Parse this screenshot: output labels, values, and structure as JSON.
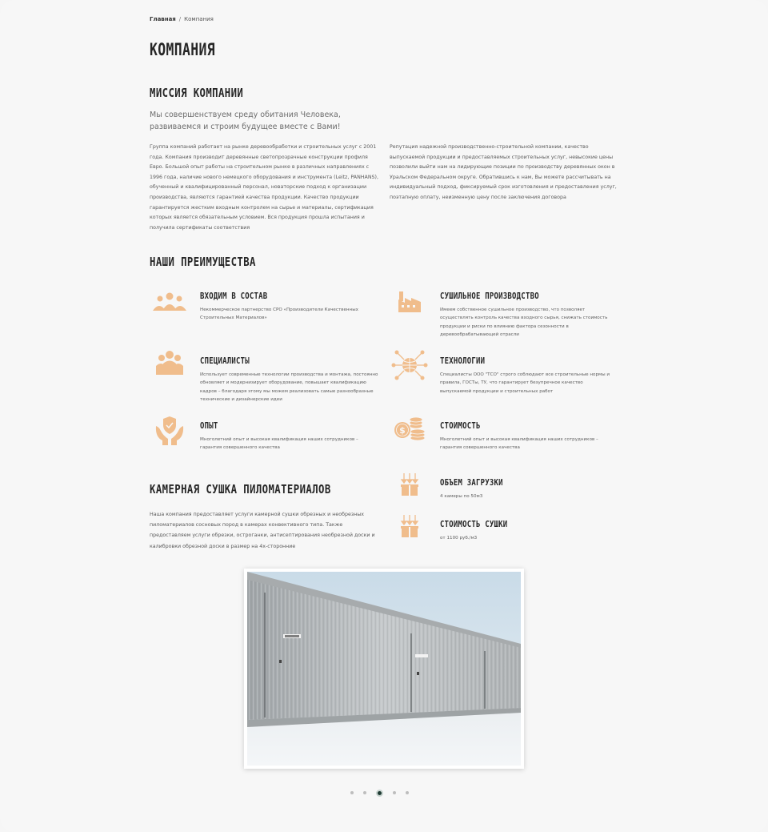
{
  "breadcrumb": {
    "home": "Главная",
    "separator": "/",
    "current": "Компания"
  },
  "page_title": "Компания",
  "mission": {
    "title": "Миссия компании",
    "lead_line1": "Мы совершенствуем среду обитания Человека,",
    "lead_line2": "развиваемся и строим будущее вместе с Вами!",
    "col1": "Группа компаний работает на рынке деревообработки и строительных услуг с 2001 года. Компания производит деревянные светопрозрачные конструкции профиля Евро. Большой опыт работы на строительном рынке в различных направлениях с 1996 года, наличие нового немецкого оборудования и инструмента (Leitz, PANHANS), обученный и квалифицированный персонал, новаторские подход к организации производства, являются гарантией качества продукции. Качество продукции гарантируется жестким входным контролем на сырье и материалы, сертификация которых является обязательным условием. Вся продукция прошла испытания и получила сертификаты соответствия",
    "col2": "Репутация надежной производственно-строительной компании, качество выпускаемой продукции и предоставляемых строительных услуг, невысокие цены позволили выйти нам на лидирующие позиции по производству деревянных окон в Уральском Федеральном округе. Обратившись к нам, Вы можете рассчитывать на индивидуальный подход, фиксируемый срок изготовления и предоставления услуг, поэтапную оплату, неизменную цену после заключения договора"
  },
  "advantages": {
    "title": "Наши преимущества",
    "items": [
      {
        "icon": "people-group-icon",
        "title": "ВХОДИМ В СОСТАВ",
        "desc": "Некоммерческое партнерство СРО «Производители Качественных Строительных Материалов»"
      },
      {
        "icon": "factory-icon",
        "title": "СУШИЛЬНОЕ ПРОИЗВОДСТВО",
        "desc": "Имеем собственное сушильное производство, что позволяет осуществлять контроль качества входного сырья, снижать стоимость продукции и риски по влиянию фактора сезонности в деревообрабатывающей отрасли"
      },
      {
        "icon": "specialists-icon",
        "title": "СПЕЦИАЛИСТЫ",
        "desc": "Использует современные технологии производства и монтажа, постоянно обновляет и модернизирует оборудование, повышает квалификацию кадров – благодаря этому мы можем реализовать самые разнообразные технические и дизайнерские идеи"
      },
      {
        "icon": "globe-network-icon",
        "title": "ТЕХНОЛОГИИ",
        "desc": "Специалисты ООО \"ТСО\" строго соблюдают все строительные нормы и правила, ГОСТы, ТУ, что гарантирует безупречное качество выпускаемой продукции и строительных работ"
      },
      {
        "icon": "shield-hands-icon",
        "title": "ОПЫТ",
        "desc": "Многолетний опыт и высокая квалификация наших сотрудников – гарантия совершенного качества"
      },
      {
        "icon": "coins-icon",
        "title": "СТОИМОСТЬ",
        "desc": "Многолетний опыт и высокая квалификация наших сотрудников – гарантия совершенного качества"
      }
    ]
  },
  "drying": {
    "title": "Камерная сушка пиломатериалов",
    "text": "Наша компания предоставляет услуги камерной сушки обрезных и необрезных пиломатериалов сосновых пород в камерах конвективного типа. Также предоставляем услуги обрезки, остроганки, антисептирования необрезной доски и калибровки обрезной доски в размер на 4х-сторонние",
    "items": [
      {
        "icon": "box-arrows-icon",
        "title": "ОБЪЕМ ЗАГРУЗКИ",
        "desc": "4 камеры по 50м3"
      },
      {
        "icon": "box-arrows-icon",
        "title": "СТОИМОСТЬ СУШКИ",
        "desc": "от 1100 руб./м3"
      }
    ]
  },
  "slider": {
    "count": 5,
    "active_index": 2
  },
  "colors": {
    "accent": "#f0bd8c",
    "dot_active": "#1f3b33",
    "text_dark": "#262626"
  }
}
